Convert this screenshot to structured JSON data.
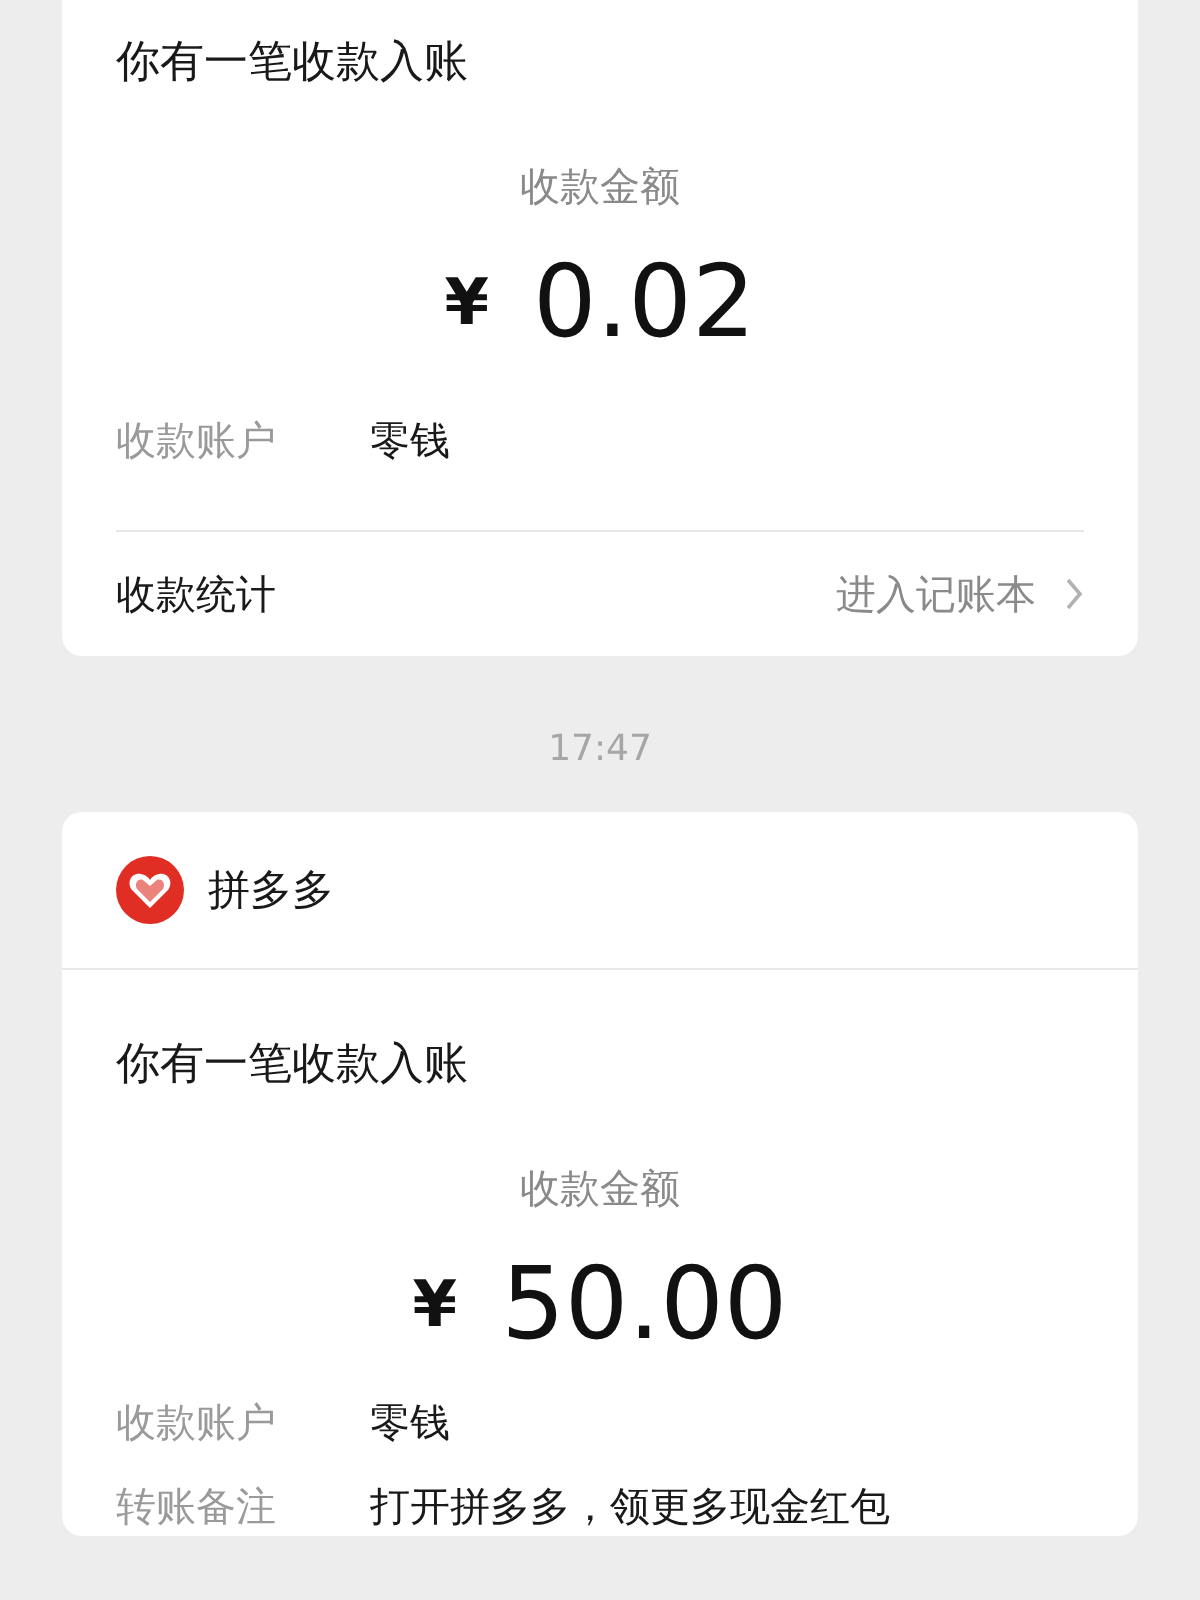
{
  "messages": [
    {
      "title": "你有一笔收款入账",
      "amount_label": "收款金额",
      "currency": "¥",
      "amount": "0.02",
      "rows": [
        {
          "label": "收款账户",
          "value": "零钱"
        }
      ],
      "footer": {
        "label": "收款统计",
        "link": "进入记账本"
      }
    },
    {
      "timestamp": "17:47",
      "sender": {
        "name": "拼多多"
      },
      "title": "你有一笔收款入账",
      "amount_label": "收款金额",
      "currency": "¥",
      "amount": "50.00",
      "rows": [
        {
          "label": "收款账户",
          "value": "零钱"
        },
        {
          "label": "转账备注",
          "value": "打开拼多多，领更多现金红包"
        }
      ]
    }
  ]
}
